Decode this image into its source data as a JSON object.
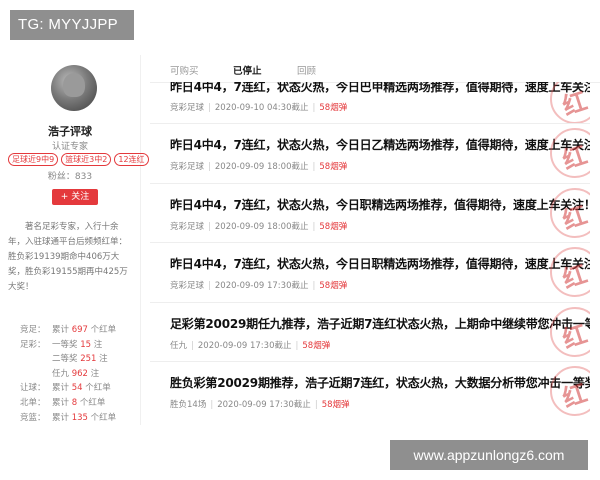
{
  "overlay": {
    "tg_text": "TG: MYYJJPP",
    "site_text": "www.appzunlongz6.com"
  },
  "profile": {
    "name": "浩子评球",
    "verified": "认证专家",
    "tags": [
      "足球近9中9",
      "篮球近3中2",
      "12连红"
    ],
    "fans": "粉丝：833",
    "follow": "+ 关注",
    "bio": "著名足彩专家，入行十余年，入驻球通平台后频频红单：胜负彩19139期命中406万大奖，胜负彩19155期再中425万大奖！"
  },
  "stats": [
    {
      "cat": "竞足：",
      "sub": "累计",
      "val": "697",
      "unit": " 个红单"
    },
    {
      "cat": "足彩：",
      "sub": "一等奖",
      "val": "15",
      "unit": " 注"
    },
    {
      "cat": "",
      "sub": "二等奖",
      "val": "251",
      "unit": " 注"
    },
    {
      "cat": "",
      "sub": "任九",
      "val": "962",
      "unit": " 注"
    },
    {
      "cat": "让球：",
      "sub": "累计",
      "val": "54",
      "unit": " 个红单"
    },
    {
      "cat": "北单：",
      "sub": "累计",
      "val": "8",
      "unit": " 个红单"
    },
    {
      "cat": "竞篮：",
      "sub": "累计",
      "val": "135",
      "unit": " 个红单"
    }
  ],
  "tabs": [
    "可购买",
    "已停止",
    "回顾"
  ],
  "articles": [
    {
      "title": "昨日4中4，7连红，状态火热，今日巴甲精选两场推荐，值得期待，速度上车关注！",
      "category": "竞彩足球",
      "time": "2020-09-10 04:30截止",
      "price": "58烟弹"
    },
    {
      "title": "昨日4中4，7连红，状态火热，今日日乙精选两场推荐，值得期待，速度上车关注！",
      "category": "竞彩足球",
      "time": "2020-09-09 18:00截止",
      "price": "58烟弹"
    },
    {
      "title": "昨日4中4，7连红，状态火热，今日职精选两场推荐，值得期待，速度上车关注！",
      "category": "竞彩足球",
      "time": "2020-09-09 18:00截止",
      "price": "58烟弹"
    },
    {
      "title": "昨日4中4，7连红，状态火热，今日日职精选两场推荐，值得期待，速度上车关注！",
      "category": "竞彩足球",
      "time": "2020-09-09 17:30截止",
      "price": "58烟弹"
    },
    {
      "title": "足彩第20029期任九推荐，浩子近期7连红状态火热，上期命中继续带您冲击一等奖！",
      "category": "任九",
      "time": "2020-09-09 17:30截止",
      "price": "58烟弹"
    },
    {
      "title": "胜负彩第20029期推荐，浩子近期7连红，状态火热，大数据分析带您冲击一等奖！",
      "category": "胜负14场",
      "time": "2020-09-09 17:30截止",
      "price": "58烟弹"
    }
  ],
  "stamp_char": "红",
  "colors": {
    "accent": "#e4393c",
    "overlay": "#8f8f8f"
  }
}
